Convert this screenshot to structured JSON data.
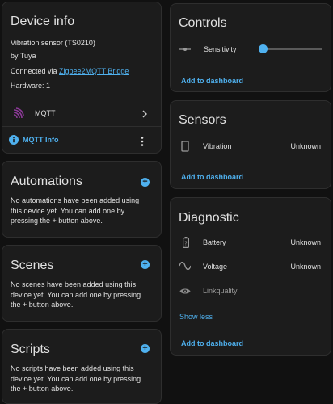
{
  "device_info": {
    "title": "Device info",
    "model": "Vibration sensor (TS0210)",
    "manufacturer": "by Tuya",
    "connected_prefix": "Connected via ",
    "connected_link": "Zigbee2MQTT Bridge",
    "hardware": "Hardware: 1",
    "integration_label": "MQTT",
    "mqtt_info_label": "MQTT Info"
  },
  "automations": {
    "title": "Automations",
    "empty_text": "No automations have been added using this device yet. You can add one by pressing the + button above."
  },
  "scenes": {
    "title": "Scenes",
    "empty_text": "No scenes have been added using this device yet. You can add one by pressing the + button above."
  },
  "scripts": {
    "title": "Scripts",
    "empty_text": "No scripts have been added using this device yet. You can add one by pressing the + button above."
  },
  "controls": {
    "title": "Controls",
    "sensitivity_label": "Sensitivity",
    "sensitivity_level": 0,
    "add_to_dashboard": "Add to dashboard"
  },
  "sensors": {
    "title": "Sensors",
    "vibration_label": "Vibration",
    "vibration_value": "Unknown",
    "add_to_dashboard": "Add to dashboard"
  },
  "diagnostic": {
    "title": "Diagnostic",
    "battery_label": "Battery",
    "battery_value": "Unknown",
    "voltage_label": "Voltage",
    "voltage_value": "Unknown",
    "linkquality_label": "Linkquality",
    "show_less": "Show less",
    "add_to_dashboard": "Add to dashboard"
  },
  "colors": {
    "accent": "#4fb1ef",
    "card_bg": "#1c1c1c",
    "page_bg": "#111111",
    "mqtt_icon": "#8e3a9a"
  }
}
